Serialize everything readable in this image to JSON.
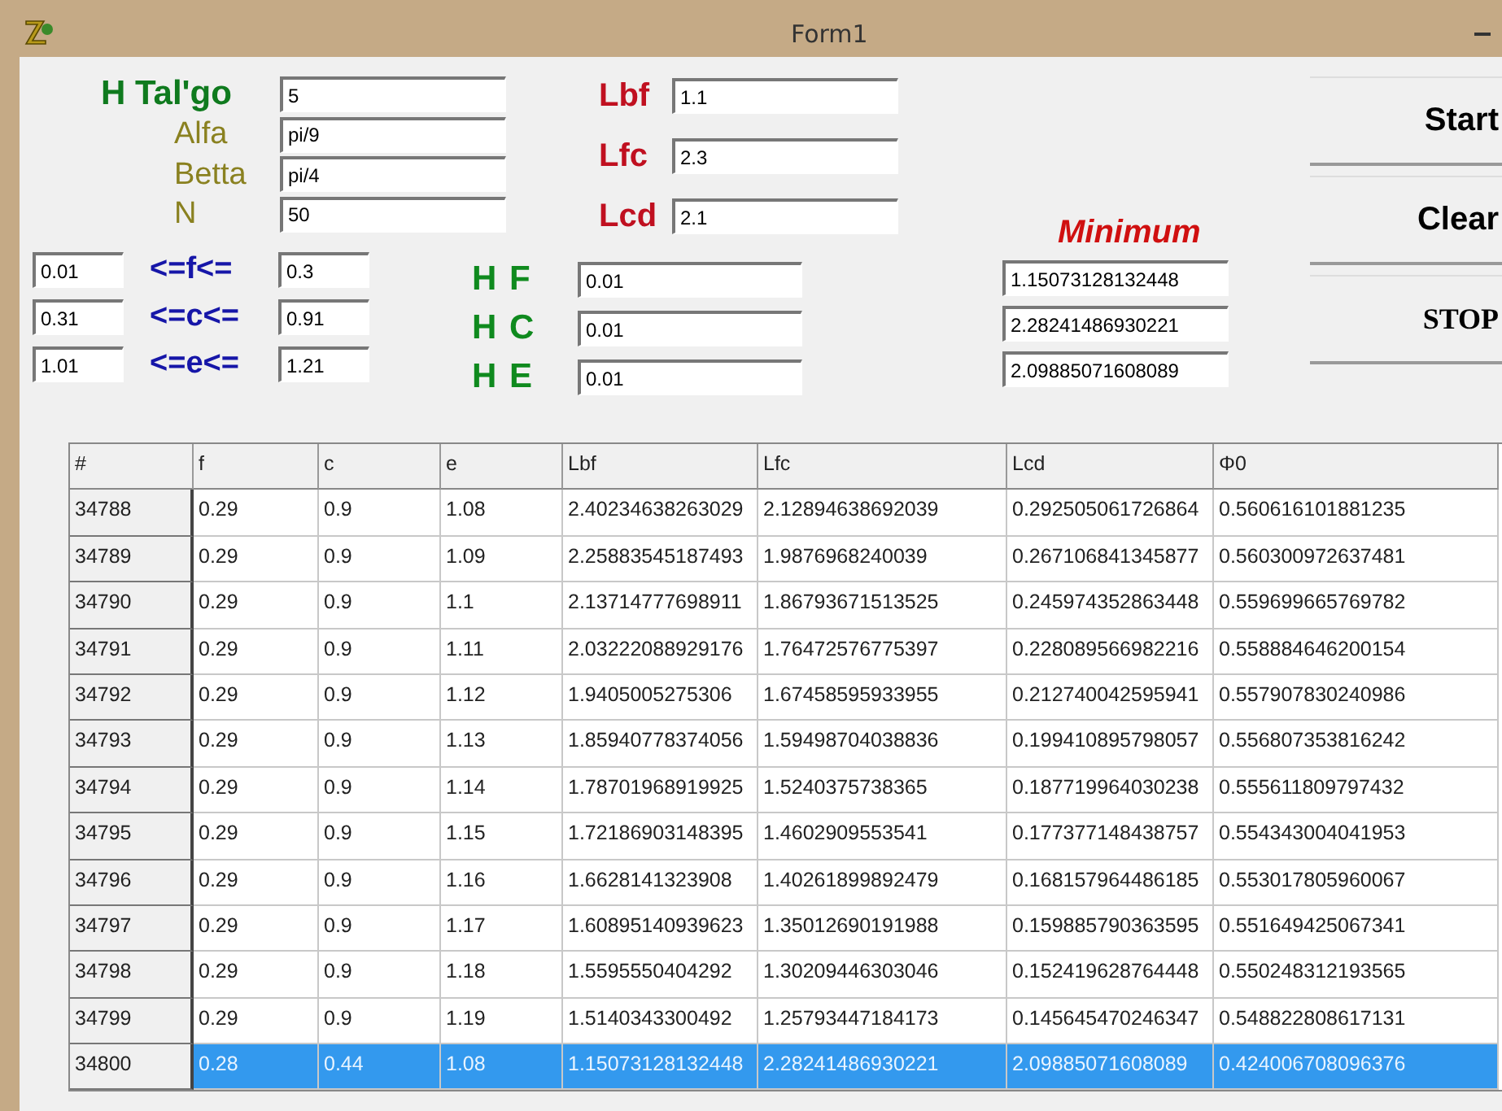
{
  "window": {
    "title": "Form1"
  },
  "parameters": [
    {
      "label": "H Tal'go",
      "kind": "main",
      "value": "5"
    },
    {
      "label": "Alfa",
      "kind": "sub",
      "value": "pi/9"
    },
    {
      "label": "Betta",
      "kind": "sub",
      "value": "pi/4"
    },
    {
      "label": "N",
      "kind": "sub",
      "value": "50"
    }
  ],
  "lengths": [
    {
      "label": "Lbf",
      "value": "1.1"
    },
    {
      "label": "Lfc",
      "value": "2.3"
    },
    {
      "label": "Lcd",
      "value": "2.1"
    }
  ],
  "ranges": [
    {
      "min": "0.01",
      "label": "<=f<=",
      "max": "0.3"
    },
    {
      "min": "0.31",
      "label": "<=c<=",
      "max": "0.91"
    },
    {
      "min": "1.01",
      "label": "<=e<=",
      "max": "1.21"
    }
  ],
  "steps": [
    {
      "label": "H F",
      "value": "0.01"
    },
    {
      "label": "H C",
      "value": "0.01"
    },
    {
      "label": "H E",
      "value": "0.01"
    }
  ],
  "minimum": {
    "label": "Minimum",
    "values": [
      "1.15073128132448",
      "2.28241486930221",
      "2.09885071608089"
    ]
  },
  "buttons": [
    {
      "label": "Start",
      "kind": "sans"
    },
    {
      "label": "Clear",
      "kind": "sans"
    },
    {
      "label": "STOP",
      "kind": "serif"
    }
  ],
  "table": {
    "columns": [
      "#",
      "f",
      "c",
      "e",
      "Lbf",
      "Lfc",
      "Lcd",
      "Φ0"
    ],
    "rows": [
      {
        "cells": [
          "34788",
          "0.29",
          "0.9",
          "1.08",
          "2.40234638263029",
          "2.12894638692039",
          "0.292505061726864",
          "0.560616101881235"
        ],
        "selected": false
      },
      {
        "cells": [
          "34789",
          "0.29",
          "0.9",
          "1.09",
          "2.25883545187493",
          "1.9876968240039",
          "0.267106841345877",
          "0.560300972637481"
        ],
        "selected": false
      },
      {
        "cells": [
          "34790",
          "0.29",
          "0.9",
          "1.1",
          "2.13714777698911",
          "1.86793671513525",
          "0.245974352863448",
          "0.559699665769782"
        ],
        "selected": false
      },
      {
        "cells": [
          "34791",
          "0.29",
          "0.9",
          "1.11",
          "2.03222088929176",
          "1.76472576775397",
          "0.228089566982216",
          "0.558884646200154"
        ],
        "selected": false
      },
      {
        "cells": [
          "34792",
          "0.29",
          "0.9",
          "1.12",
          "1.9405005275306",
          "1.67458595933955",
          "0.212740042595941",
          "0.557907830240986"
        ],
        "selected": false
      },
      {
        "cells": [
          "34793",
          "0.29",
          "0.9",
          "1.13",
          "1.85940778374056",
          "1.59498704038836",
          "0.199410895798057",
          "0.556807353816242"
        ],
        "selected": false
      },
      {
        "cells": [
          "34794",
          "0.29",
          "0.9",
          "1.14",
          "1.78701968919925",
          "1.5240375738365",
          "0.187719964030238",
          "0.555611809797432"
        ],
        "selected": false
      },
      {
        "cells": [
          "34795",
          "0.29",
          "0.9",
          "1.15",
          "1.72186903148395",
          "1.4602909553541",
          "0.177377148438757",
          "0.554343004041953"
        ],
        "selected": false
      },
      {
        "cells": [
          "34796",
          "0.29",
          "0.9",
          "1.16",
          "1.6628141323908",
          "1.40261899892479",
          "0.168157964486185",
          "0.553017805960067"
        ],
        "selected": false
      },
      {
        "cells": [
          "34797",
          "0.29",
          "0.9",
          "1.17",
          "1.60895140939623",
          "1.35012690191988",
          "0.159885790363595",
          "0.551649425067341"
        ],
        "selected": false
      },
      {
        "cells": [
          "34798",
          "0.29",
          "0.9",
          "1.18",
          "1.5595550404292",
          "1.30209446303046",
          "0.152419628764448",
          "0.550248312193565"
        ],
        "selected": false
      },
      {
        "cells": [
          "34799",
          "0.29",
          "0.9",
          "1.19",
          "1.5140343300492",
          "1.25793447184173",
          "0.145645470246347",
          "0.548822808617131"
        ],
        "selected": false
      },
      {
        "cells": [
          "34800",
          "0.28",
          "0.44",
          "1.08",
          "1.15073128132448",
          "2.28241486930221",
          "2.09885071608089",
          "0.424006708096376"
        ],
        "selected": true
      }
    ]
  }
}
